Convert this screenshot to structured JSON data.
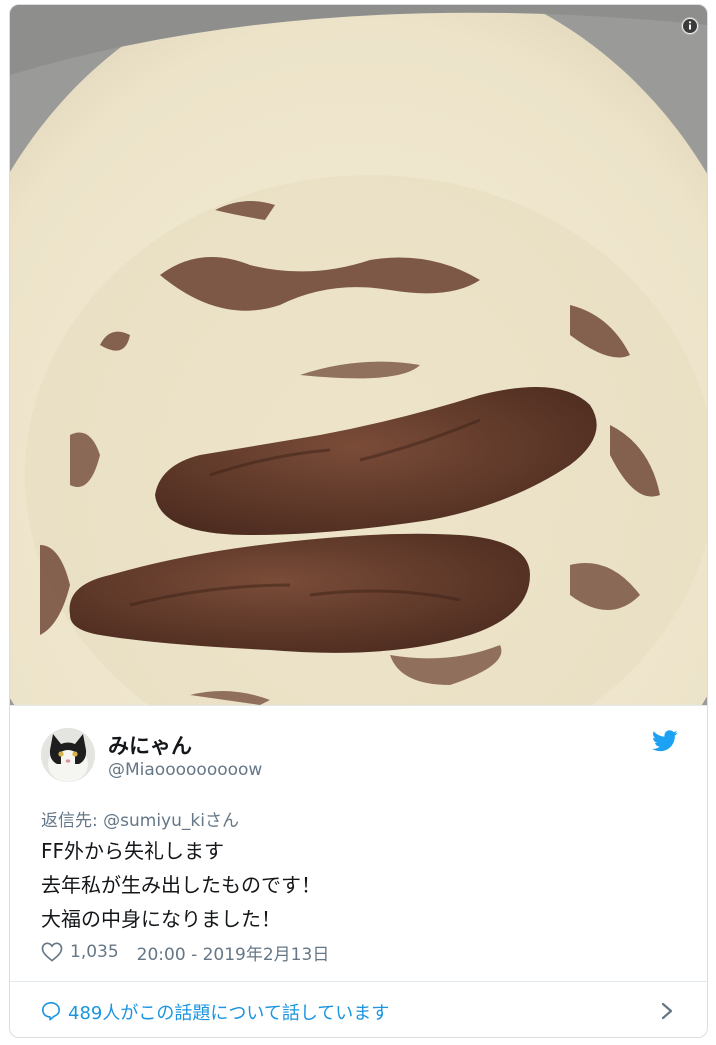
{
  "photo": {
    "subject": "bowl with chocolate-colored bean paste",
    "colors": {
      "bowl": "#ece3c9",
      "paste": "#6a4030",
      "paste_dark": "#4a2a1e",
      "rim_shadow": "#c9bf9f"
    }
  },
  "tweet": {
    "display_name": "みにゃん",
    "handle": "@Miaooooooooow",
    "reply_to_label": "返信先: ",
    "reply_to_mention": "@sumiyu_ki",
    "reply_to_suffix": "さん",
    "text_lines": [
      "FF外から失礼します",
      "去年私が生み出したものです！",
      "大福の中身になりました！"
    ],
    "likes": "1,035",
    "timestamp": "20:00 - 2019年2月13日"
  },
  "footer": {
    "conversation_text": "489人がこの話題について話しています"
  },
  "icons": {
    "info": "info-icon",
    "bird": "twitter-bird-icon",
    "heart": "heart-icon",
    "bubble": "speech-bubble-icon",
    "chevron": "chevron-right-icon"
  },
  "colors": {
    "twitter_blue": "#1da1f2",
    "link_blue": "#1b95e0",
    "secondary_text": "#657786",
    "primary_text": "#14171a",
    "border": "#e1e8ed"
  }
}
